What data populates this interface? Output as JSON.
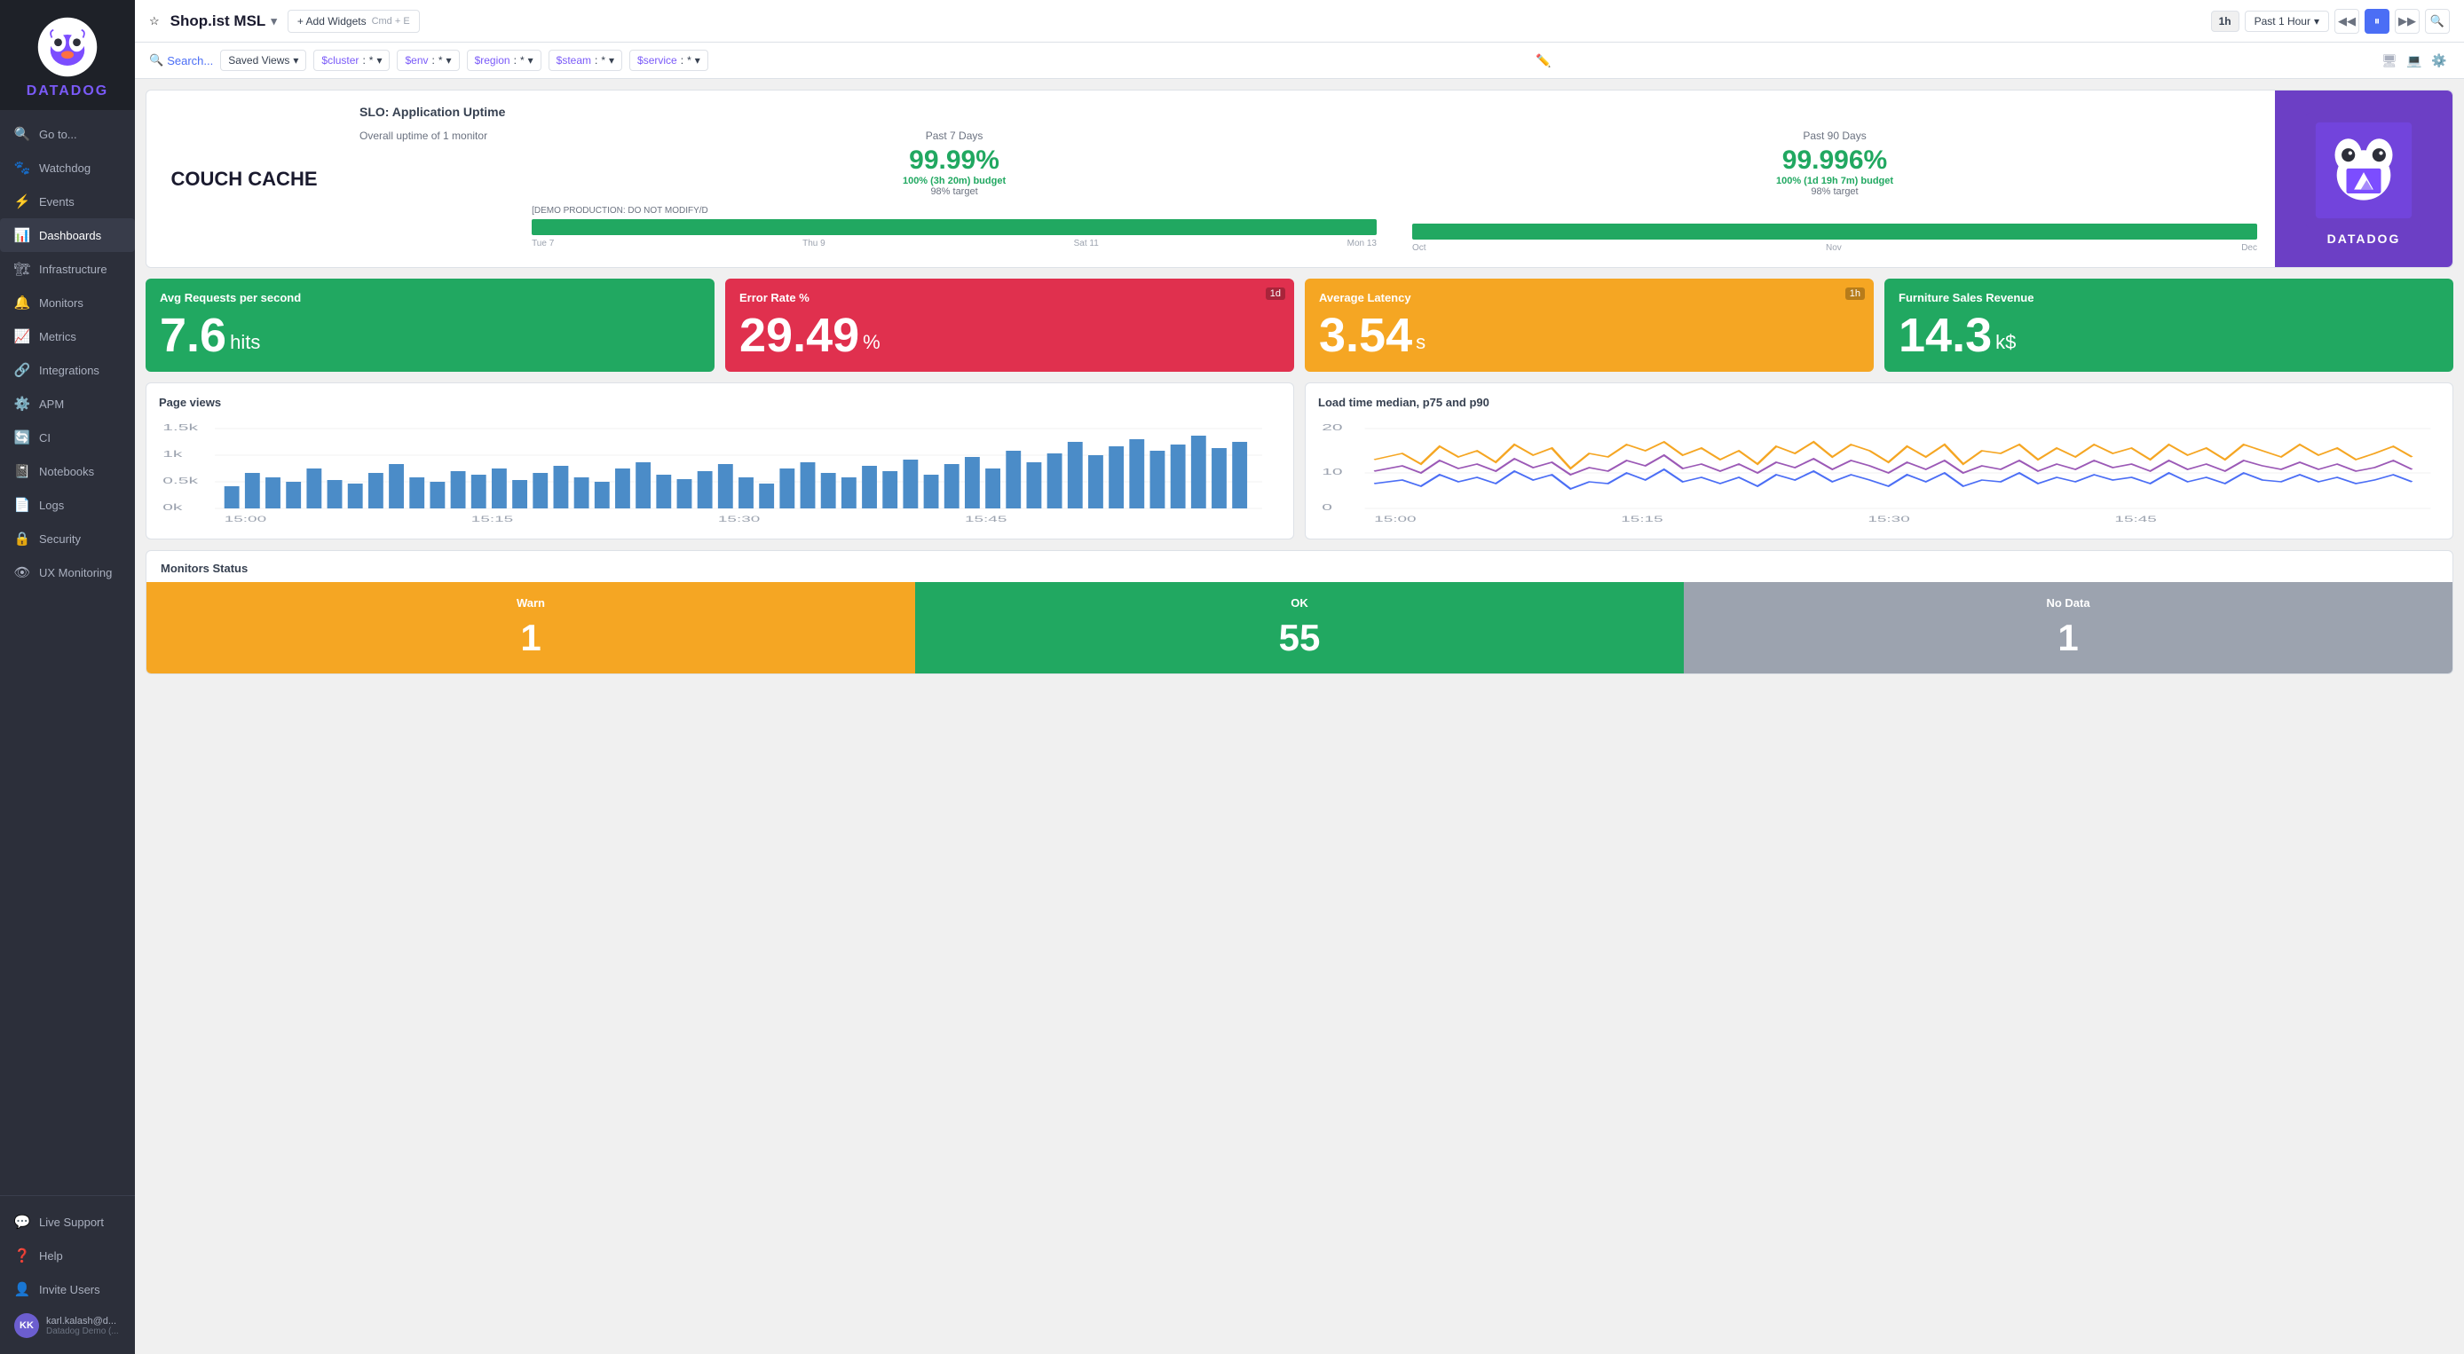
{
  "sidebar": {
    "brand": "DATADOG",
    "nav_items": [
      {
        "id": "goto",
        "label": "Go to...",
        "icon": "🔍"
      },
      {
        "id": "watchdog",
        "label": "Watchdog",
        "icon": "🐾"
      },
      {
        "id": "events",
        "label": "Events",
        "icon": "⚡"
      },
      {
        "id": "dashboards",
        "label": "Dashboards",
        "icon": "📊",
        "active": true
      },
      {
        "id": "infrastructure",
        "label": "Infrastructure",
        "icon": "🏗"
      },
      {
        "id": "monitors",
        "label": "Monitors",
        "icon": "🔔"
      },
      {
        "id": "metrics",
        "label": "Metrics",
        "icon": "📈"
      },
      {
        "id": "integrations",
        "label": "Integrations",
        "icon": "🔗"
      },
      {
        "id": "apm",
        "label": "APM",
        "icon": "⚙️"
      },
      {
        "id": "ci",
        "label": "CI",
        "icon": "🔄"
      },
      {
        "id": "notebooks",
        "label": "Notebooks",
        "icon": "📓"
      },
      {
        "id": "logs",
        "label": "Logs",
        "icon": "📄"
      },
      {
        "id": "security",
        "label": "Security",
        "icon": "🔒"
      },
      {
        "id": "ux",
        "label": "UX Monitoring",
        "icon": "👁"
      }
    ],
    "bottom_items": [
      {
        "id": "live-support",
        "label": "Live Support",
        "icon": "💬"
      },
      {
        "id": "help",
        "label": "Help",
        "icon": "❓"
      },
      {
        "id": "invite",
        "label": "Invite Users",
        "icon": "👤"
      }
    ],
    "user": {
      "email": "karl.kalash@d...",
      "role": "Datadog Demo (...",
      "initials": "KK"
    }
  },
  "header": {
    "title": "Shop.ist MSL",
    "add_widgets_label": "+ Add Widgets",
    "add_widgets_shortcut": "Cmd + E",
    "time_range_short": "1h",
    "time_range_label": "Past 1 Hour"
  },
  "filterbar": {
    "search_label": "Search...",
    "saved_views_label": "Saved Views",
    "filters": [
      {
        "key": "$cluster",
        "value": "*"
      },
      {
        "key": "$env",
        "value": "*"
      },
      {
        "key": "$region",
        "value": "*"
      },
      {
        "key": "$steam",
        "value": "*"
      },
      {
        "key": "$service",
        "value": "*"
      }
    ]
  },
  "slo_widget": {
    "brand_label": "COUCH CACHE",
    "title": "SLO: Application Uptime",
    "monitor_label": "Overall uptime of 1 monitor",
    "period_7d": {
      "label": "Past 7 Days",
      "percent": "99.99%",
      "budget": "100% (3h 20m)",
      "target": "98% target",
      "dates": [
        "Tue 7",
        "Thu 9",
        "Sat 11",
        "Mon 13"
      ]
    },
    "period_90d": {
      "label": "Past 90 Days",
      "percent": "99.996%",
      "budget": "100% (1d 19h 7m)",
      "target": "98% target",
      "dates": [
        "Oct",
        "Nov",
        "Dec"
      ]
    },
    "demo_label": "[DEMO PRODUCTION: DO NOT MODIFY/D"
  },
  "metrics": [
    {
      "id": "avg-requests",
      "title": "Avg Requests per second",
      "value": "7.6",
      "unit": "hits",
      "color": "green",
      "badge": null
    },
    {
      "id": "error-rate",
      "title": "Error Rate %",
      "value": "29.49",
      "unit": "%",
      "color": "red",
      "badge": "1d"
    },
    {
      "id": "avg-latency",
      "title": "Average Latency",
      "value": "3.54",
      "unit": "s",
      "color": "orange",
      "badge": "1h"
    },
    {
      "id": "furniture-sales",
      "title": "Furniture Sales Revenue",
      "value": "14.3",
      "unit": "k$",
      "color": "green2",
      "badge": null
    }
  ],
  "charts": [
    {
      "id": "page-views",
      "title": "Page views",
      "type": "bar",
      "y_labels": [
        "1.5k",
        "1k",
        "0.5k",
        "0k"
      ],
      "x_labels": [
        "15:00",
        "15:15",
        "15:30",
        "15:45"
      ]
    },
    {
      "id": "load-time",
      "title": "Load time median, p75 and p90",
      "type": "line",
      "y_labels": [
        "20",
        "10",
        "0"
      ],
      "x_labels": [
        "15:00",
        "15:15",
        "15:30",
        "15:45"
      ]
    }
  ],
  "monitors": {
    "title": "Monitors Status",
    "cells": [
      {
        "label": "Warn",
        "count": "1",
        "type": "warn"
      },
      {
        "label": "OK",
        "count": "55",
        "type": "ok"
      },
      {
        "label": "No Data",
        "count": "1",
        "type": "nodata"
      }
    ]
  }
}
